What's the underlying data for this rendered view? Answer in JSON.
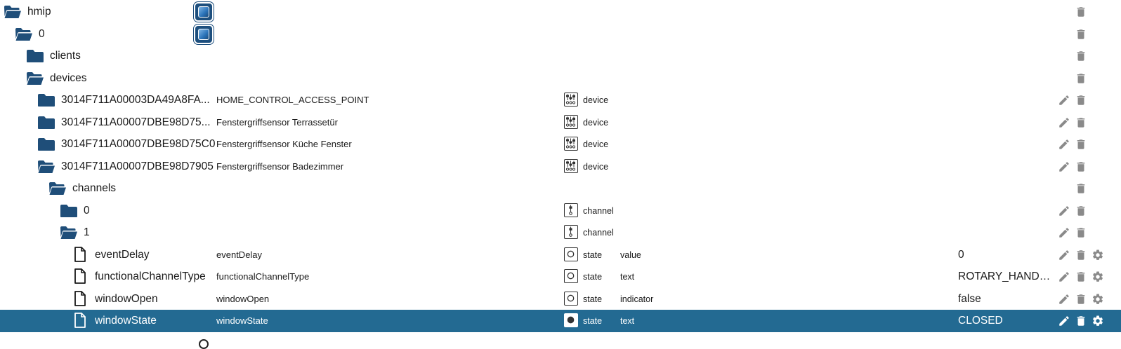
{
  "colors": {
    "folder": "#1f4e79",
    "selected_row": "#236a92",
    "action_icon": "#8a8a8a"
  },
  "rows": [
    {
      "kind": "folder-open",
      "level": 0,
      "name": "hmip",
      "has_app_icon": true,
      "delete": true
    },
    {
      "kind": "folder-open",
      "level": 1,
      "name": "0",
      "has_app_icon": true,
      "delete": true
    },
    {
      "kind": "folder",
      "level": 2,
      "name": "clients",
      "delete": true
    },
    {
      "kind": "folder-open",
      "level": 2,
      "name": "devices",
      "delete": true
    },
    {
      "kind": "folder",
      "level": 3,
      "name": "3014F711A00003DA49A8FA...",
      "desc": "HOME_CONTROL_ACCESS_POINT",
      "type_icon": "device-icon",
      "type": "device",
      "edit": true,
      "delete": true
    },
    {
      "kind": "folder",
      "level": 3,
      "name": "3014F711A00007DBE98D75...",
      "desc": "Fenstergriffsensor Terrassetür",
      "type_icon": "device-icon",
      "type": "device",
      "edit": true,
      "delete": true
    },
    {
      "kind": "folder",
      "level": 3,
      "name": "3014F711A00007DBE98D75C0",
      "desc": "Fenstergriffsensor Küche Fenster",
      "type_icon": "device-icon",
      "type": "device",
      "edit": true,
      "delete": true
    },
    {
      "kind": "folder-open",
      "level": 3,
      "name": "3014F711A00007DBE98D7905",
      "desc": "Fenstergriffsensor Badezimmer",
      "type_icon": "device-icon",
      "type": "device",
      "edit": true,
      "delete": true
    },
    {
      "kind": "folder-open",
      "level": 4,
      "name": "channels",
      "delete": true
    },
    {
      "kind": "folder",
      "level": 5,
      "name": "0",
      "type_icon": "channel-icon",
      "type": "channel",
      "edit": true,
      "delete": true
    },
    {
      "kind": "folder-open",
      "level": 5,
      "name": "1",
      "type_icon": "channel-icon",
      "type": "channel",
      "edit": true,
      "delete": true
    },
    {
      "kind": "state",
      "level": 6,
      "name": "eventDelay",
      "desc": "eventDelay",
      "type_icon": "state-icon",
      "type": "state",
      "role": "value",
      "value": "0",
      "edit": true,
      "delete": true,
      "gear": true
    },
    {
      "kind": "state",
      "level": 6,
      "name": "functionalChannelType",
      "desc": "functionalChannelType",
      "type_icon": "state-icon",
      "type": "state",
      "role": "text",
      "value": "ROTARY_HANDLE_CHANNEL",
      "edit": true,
      "delete": true,
      "gear": true
    },
    {
      "kind": "state",
      "level": 6,
      "name": "windowOpen",
      "desc": "windowOpen",
      "type_icon": "state-icon",
      "type": "state",
      "role": "indicator",
      "value": "false",
      "edit": true,
      "delete": true,
      "gear": true
    },
    {
      "kind": "state",
      "level": 6,
      "name": "windowState",
      "desc": "windowState",
      "type_icon": "state-icon",
      "type": "state",
      "role": "text",
      "value": "CLOSED",
      "edit": true,
      "delete": true,
      "gear": true,
      "selected": true
    }
  ]
}
